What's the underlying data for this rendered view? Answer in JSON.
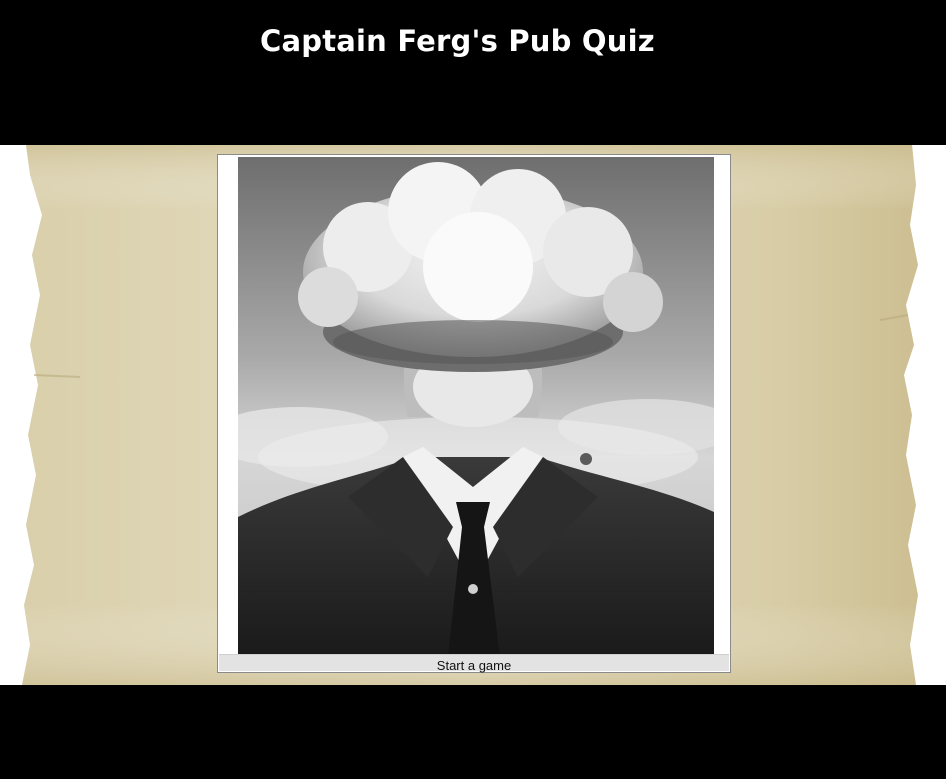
{
  "header": {
    "title": "Captain Ferg's Pub Quiz"
  },
  "main": {
    "image": {
      "icon": "mushroom-cloud-suit-image"
    },
    "start_label": "Start a game"
  },
  "colors": {
    "background": "#000000",
    "title_text": "#ffffff",
    "parchment": "#d8cfae",
    "caption_bar": "#e3e3e3"
  }
}
